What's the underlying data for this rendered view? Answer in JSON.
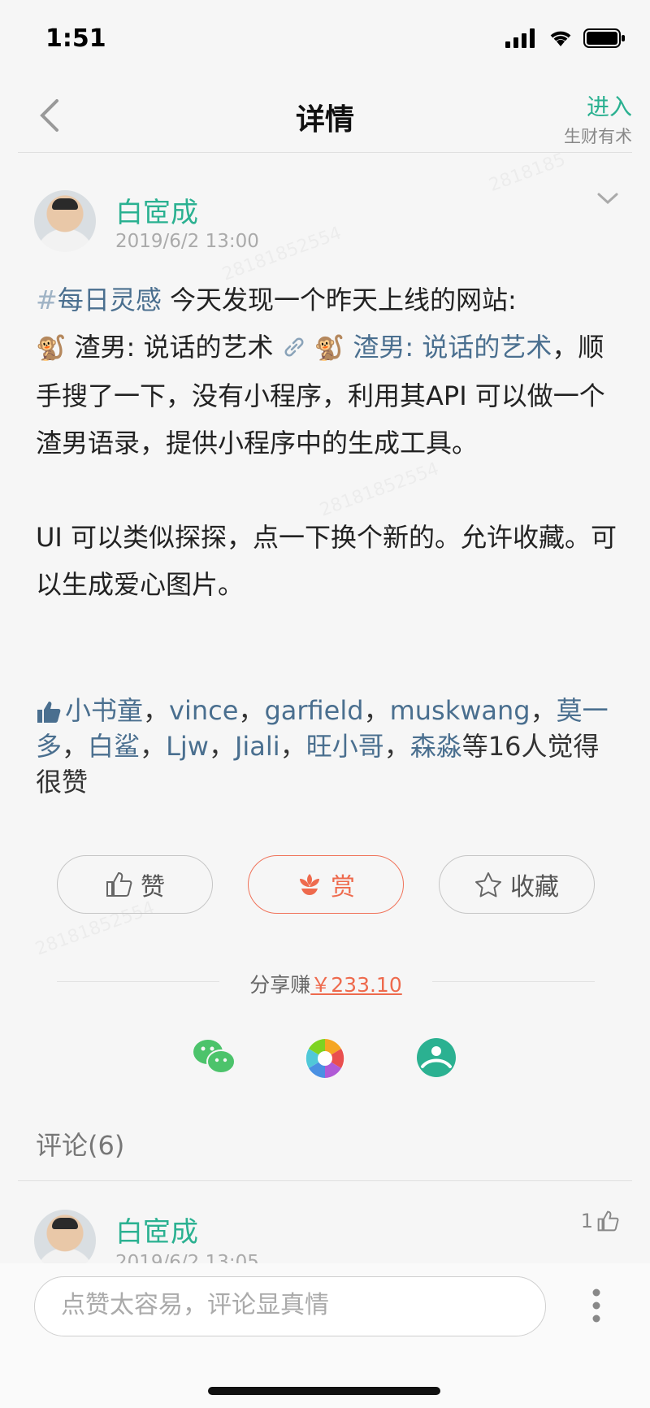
{
  "status_bar": {
    "time": "1:51"
  },
  "nav": {
    "title": "详情",
    "enter_label": "进入",
    "enter_sub": "生财有术"
  },
  "post": {
    "author": "白宧成",
    "time": "2019/6/2 13:00",
    "tag_hash": "#",
    "tag": "每日灵感",
    "intro": " 今天发现一个昨天上线的网站:",
    "emoji1": "🐒",
    "site_text": " 渣男: 说话的艺术 ",
    "emoji2": "🐒",
    "link_text": " 渣男: 说话的艺术",
    "rest1": "，顺手搜了一下，没有小程序，利用其API 可以做一个渣男语录，提供小程序中的生成工具。",
    "para2": "UI 可以类似探探，点一下换个新的。允许收藏。可以生成爱心图片。"
  },
  "likes": {
    "users": [
      "小书童",
      "vince",
      "garfield",
      "muskwang",
      "莫一多",
      "白鲨",
      "Ljw",
      "Jiali",
      "旺小哥",
      "森淼"
    ],
    "separator": "，",
    "suffix": "等16人觉得很赞"
  },
  "actions": {
    "like": "赞",
    "reward": "赏",
    "favorite": "收藏"
  },
  "share": {
    "label": "分享赚",
    "amount": "￥233.10"
  },
  "comments": {
    "title": "评论(6)",
    "items": [
      {
        "author": "白宧成",
        "time": "2019/6/2 13:05",
        "likes": "1"
      }
    ]
  },
  "input": {
    "placeholder": "点赞太容易，评论显真情"
  },
  "colors": {
    "accent": "#2bb191",
    "link": "#4a6f8f",
    "reward": "#ee6a4d"
  },
  "icons": [
    "back-icon",
    "chevron-down-icon",
    "link-icon",
    "thumbs-up-icon",
    "reward-icon",
    "star-icon",
    "wechat-icon",
    "moments-icon",
    "app-share-icon",
    "more-icon"
  ]
}
